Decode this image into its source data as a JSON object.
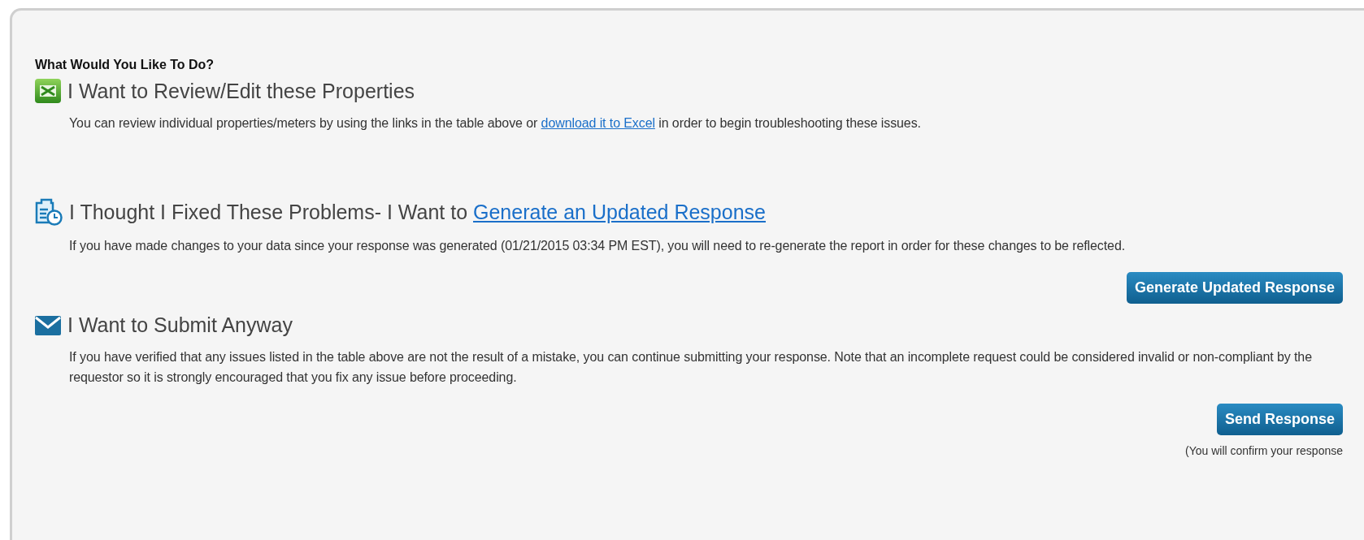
{
  "heading": "What Would You Like To Do?",
  "sections": [
    {
      "title": [
        {
          "text": "I Want to Review/Edit these Properties"
        }
      ],
      "description": [
        {
          "text": "You can review individual properties/meters by using the links in the table above or "
        },
        {
          "link": "download it to Excel"
        },
        {
          "text": " in order to begin troubleshooting these issues."
        }
      ]
    },
    {
      "title": [
        {
          "text": "I Thought I Fixed These Problems- I Want to "
        },
        {
          "link": "Generate an Updated Response"
        }
      ],
      "description": [
        {
          "text": "If you have made changes to your data since your response was generated (01/21/2015 03:34 PM EST), you will need to re-generate the report in order for these changes to be reflected."
        }
      ],
      "button": "Generate Updated Response"
    },
    {
      "title": [
        {
          "text": "I Want to Submit Anyway"
        }
      ],
      "description": [
        {
          "text": "If you have verified that any issues listed in the table above are not the result of a mistake, you can continue submitting your response. Note that an incomplete request could be considered invalid or non-compliant by the requestor so it is strongly encouraged that you fix any issue before proceeding."
        }
      ],
      "button": "Send Response",
      "note": "(You will confirm your response"
    }
  ]
}
